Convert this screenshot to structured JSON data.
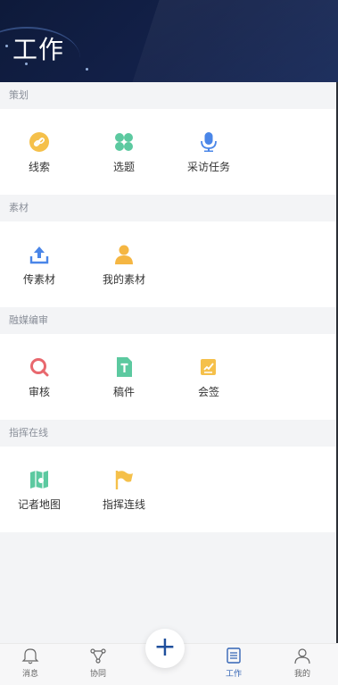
{
  "header": {
    "title": "工作"
  },
  "sections": [
    {
      "label": "策划",
      "items": [
        {
          "label": "线索",
          "icon": "link-icon"
        },
        {
          "label": "选题",
          "icon": "grid-icon"
        },
        {
          "label": "采访任务",
          "icon": "microphone-icon"
        }
      ]
    },
    {
      "label": "素材",
      "items": [
        {
          "label": "传素材",
          "icon": "upload-icon"
        },
        {
          "label": "我的素材",
          "icon": "user-icon"
        }
      ]
    },
    {
      "label": "融媒编审",
      "items": [
        {
          "label": "审核",
          "icon": "review-icon"
        },
        {
          "label": "稿件",
          "icon": "document-icon"
        },
        {
          "label": "会签",
          "icon": "sign-icon"
        }
      ]
    },
    {
      "label": "指挥在线",
      "items": [
        {
          "label": "记者地图",
          "icon": "map-icon"
        },
        {
          "label": "指挥连线",
          "icon": "flag-icon"
        }
      ]
    }
  ],
  "tabbar": [
    {
      "label": "消息",
      "icon": "bell-icon"
    },
    {
      "label": "协同",
      "icon": "network-icon"
    },
    {
      "label": "工作",
      "icon": "list-icon",
      "active": true
    },
    {
      "label": "我的",
      "icon": "person-icon"
    }
  ],
  "fab": {
    "symbol": "+"
  },
  "colors": {
    "accent": "#3465b5",
    "header": "#13214a",
    "yellow": "#f5c04a",
    "green": "#5cc9a0",
    "blue": "#4a86e8",
    "red": "#e8686e"
  }
}
